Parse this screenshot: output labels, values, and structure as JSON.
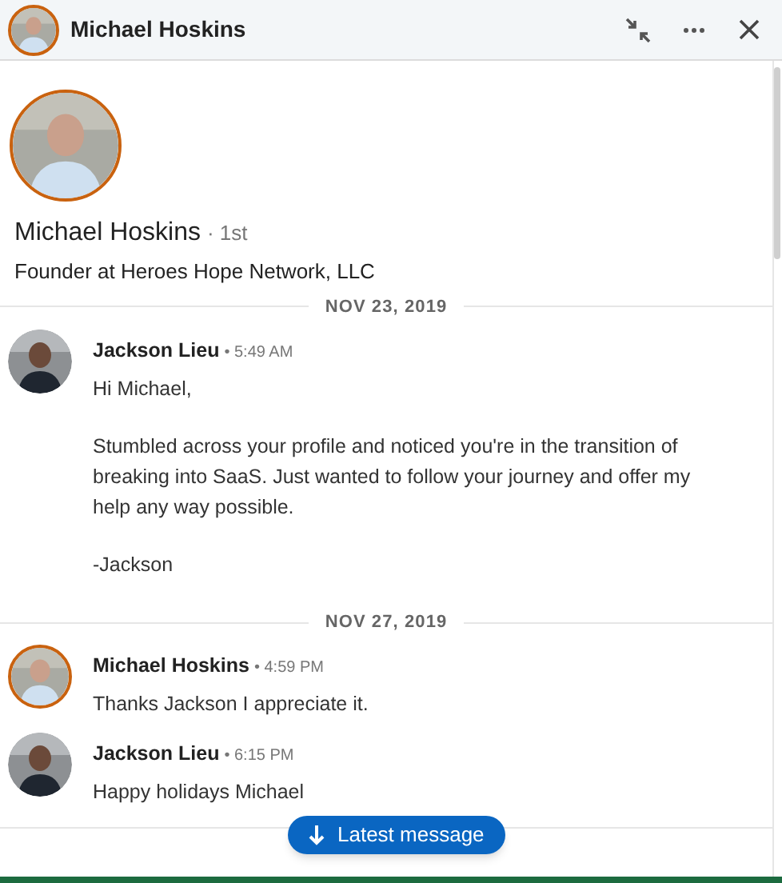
{
  "header": {
    "title": "Michael Hoskins"
  },
  "profile": {
    "name": "Michael Hoskins",
    "degree": "· 1st",
    "headline": "Founder at Heroes Hope Network, LLC"
  },
  "days": [
    {
      "date": "NOV 23, 2019",
      "messages": [
        {
          "sender": "Jackson Lieu",
          "time": "• 5:49 AM",
          "ring": false,
          "paragraphs": [
            "Hi Michael,",
            "Stumbled across your profile and noticed you're in the transition of breaking into SaaS. Just wanted to follow your journey and offer my help any way possible.",
            "-Jackson"
          ]
        }
      ]
    },
    {
      "date": "NOV 27, 2019",
      "messages": [
        {
          "sender": "Michael Hoskins",
          "time": "• 4:59 PM",
          "ring": true,
          "paragraphs": [
            "Thanks Jackson I appreciate it."
          ]
        },
        {
          "sender": "Jackson Lieu",
          "time": "• 6:15 PM",
          "ring": false,
          "paragraphs": [
            "Happy holidays Michael"
          ]
        }
      ]
    }
  ],
  "jump_button": {
    "label": "Latest message"
  }
}
